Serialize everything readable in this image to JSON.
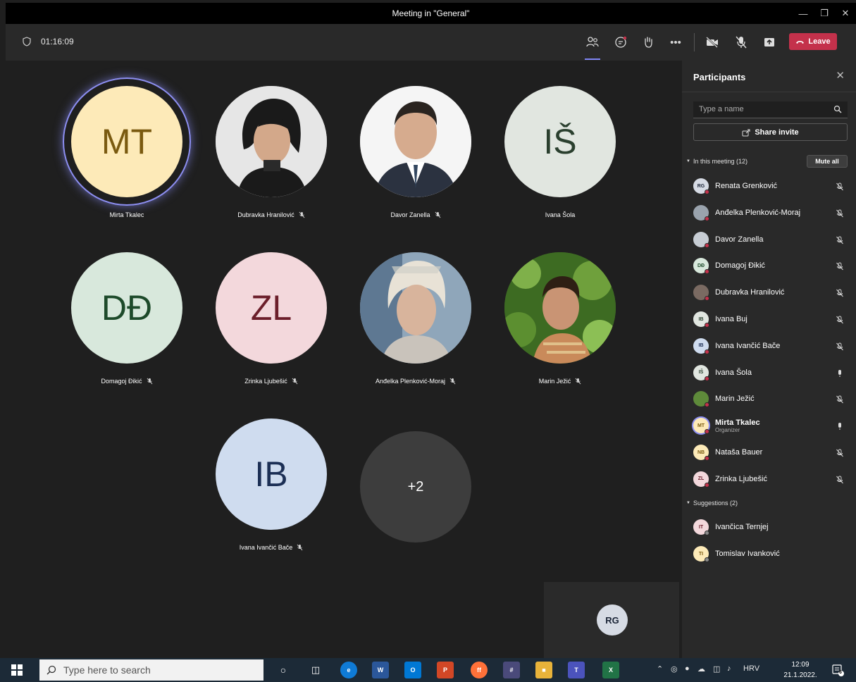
{
  "window": {
    "title": "Meeting in \"General\""
  },
  "toolbar": {
    "timer": "01:16:09",
    "leave_label": "Leave"
  },
  "tiles": [
    {
      "initials": "MT",
      "name": "Mirta Tkalec",
      "muted": false,
      "bg": "#fdeab8",
      "fg": "#7a5a10",
      "speaking": true
    },
    {
      "initials": "",
      "name": "Dubravka Hranilović",
      "muted": true,
      "photo": "woman-dark-hair"
    },
    {
      "initials": "",
      "name": "Davor Zanella",
      "muted": true,
      "photo": "man-suit"
    },
    {
      "initials": "IŠ",
      "name": "Ivana Šola",
      "muted": false,
      "bg": "#e1e6e0",
      "fg": "#2a3f2e"
    },
    {
      "initials": "DĐ",
      "name": "Domagoj Đikić",
      "muted": true,
      "bg": "#d8e8dc",
      "fg": "#1d4a2a"
    },
    {
      "initials": "ZL",
      "name": "Zrinka Ljubešić",
      "muted": true,
      "bg": "#f3d8dc",
      "fg": "#6b1e2a"
    },
    {
      "initials": "",
      "name": "Anđelka Plenković-Moraj",
      "muted": true,
      "photo": "woman-blonde"
    },
    {
      "initials": "",
      "name": "Marin Ježić",
      "muted": true,
      "photo": "man-outdoor"
    },
    {
      "initials": "IB",
      "name": "Ivana Ivančić Bače",
      "muted": true,
      "bg": "#cfdcef",
      "fg": "#1c2f55"
    },
    {
      "initials": "+2",
      "name": "",
      "muted": false,
      "bg": "#3d3d3d",
      "fg": "#ffffff"
    }
  ],
  "self_view": {
    "initials": "RG"
  },
  "panel": {
    "title": "Participants",
    "search_placeholder": "Type a name",
    "share_label": "Share invite",
    "in_meeting_label": "In this meeting (12)",
    "mute_all_label": "Mute all",
    "suggestions_label": "Suggestions (2)",
    "participants": [
      {
        "initials": "RG",
        "name": "Renata Grenković",
        "mic": "off",
        "bg": "#d6dbe4",
        "fg": "#1a2436"
      },
      {
        "initials": "",
        "name": "Anđelka Plenković-Moraj",
        "mic": "off",
        "photo": true,
        "bg": "#9aa3ad"
      },
      {
        "initials": "",
        "name": "Davor Zanella",
        "mic": "off",
        "photo": true,
        "bg": "#c7cdd4"
      },
      {
        "initials": "DĐ",
        "name": "Domagoj Đikić",
        "mic": "off",
        "bg": "#d8e8dc",
        "fg": "#1d4a2a"
      },
      {
        "initials": "",
        "name": "Dubravka Hranilović",
        "mic": "off",
        "photo": true,
        "bg": "#7a6a62"
      },
      {
        "initials": "IB",
        "name": "Ivana Buj",
        "mic": "off",
        "bg": "#e1e6e0",
        "fg": "#2a3f2e"
      },
      {
        "initials": "IB",
        "name": "Ivana Ivančić Bače",
        "mic": "off",
        "bg": "#cfdcef",
        "fg": "#1c2f55"
      },
      {
        "initials": "IŠ",
        "name": "Ivana Šola",
        "mic": "on",
        "bg": "#e1e6e0",
        "fg": "#2a3f2e"
      },
      {
        "initials": "",
        "name": "Marin Ježić",
        "mic": "off",
        "photo": true,
        "bg": "#5e8a3a"
      },
      {
        "initials": "MT",
        "name": "Mirta Tkalec",
        "sub": "Organizer",
        "mic": "on",
        "bg": "#fdeab8",
        "fg": "#7a5a10",
        "ring": true
      },
      {
        "initials": "NB",
        "name": "Nataša Bauer",
        "mic": "off",
        "bg": "#fdeab8",
        "fg": "#7a5a10"
      },
      {
        "initials": "ZL",
        "name": "Zrinka Ljubešić",
        "mic": "off",
        "bg": "#f3d8dc",
        "fg": "#6b1e2a"
      }
    ],
    "suggestions": [
      {
        "initials": "IT",
        "name": "Ivančica Ternjej",
        "bg": "#f3d8dc",
        "fg": "#6b1e2a"
      },
      {
        "initials": "TI",
        "name": "Tomislav Ivanković",
        "bg": "#fdeab8",
        "fg": "#7a5a10"
      }
    ]
  },
  "taskbar": {
    "search_placeholder": "Type here to search",
    "language": "HRV",
    "time": "12:09",
    "date": "21.1.2022.",
    "notification_count": "6"
  },
  "colors": {
    "accent": "#6264a7",
    "leave": "#c4314b",
    "panel_bg": "#292929",
    "stage_bg": "#1f1f1f"
  }
}
